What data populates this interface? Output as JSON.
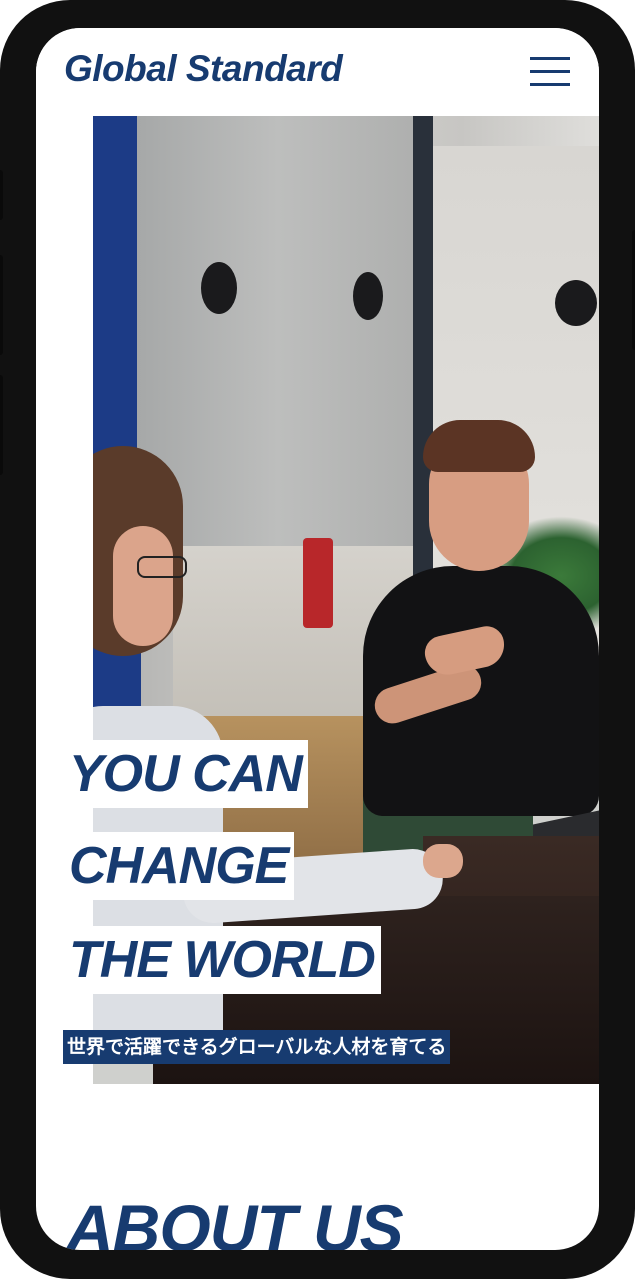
{
  "header": {
    "logo": "Global Standard",
    "menu_icon": "hamburger-menu-icon"
  },
  "hero": {
    "headline_lines": [
      "YOU CAN",
      "CHANGE",
      "THE WORLD"
    ],
    "subheadline": "世界で活躍できるグローバルな人材を育てる"
  },
  "about": {
    "title": "ABOUT US"
  },
  "colors": {
    "brand": "#173b70",
    "background": "#ffffff"
  }
}
